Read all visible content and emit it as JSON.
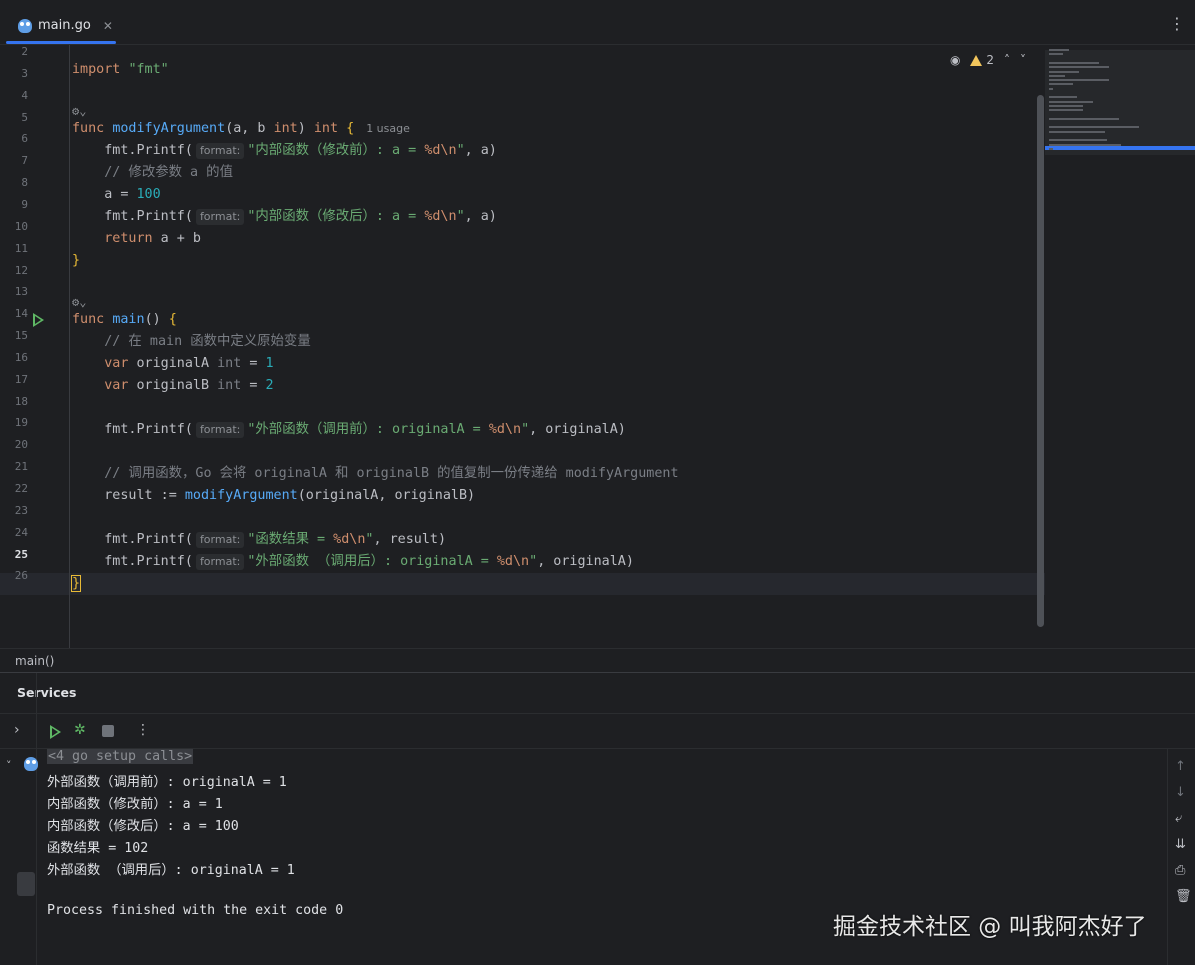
{
  "tabs": [
    {
      "label": "main.go",
      "icon": "go-file-icon",
      "active": true
    }
  ],
  "editor": {
    "line_numbers": [
      "2",
      "3",
      "4",
      "5",
      "6",
      "7",
      "8",
      "9",
      "10",
      "11",
      "12",
      "13",
      "14",
      "15",
      "16",
      "17",
      "18",
      "19",
      "20",
      "21",
      "22",
      "23",
      "24",
      "25",
      "26"
    ],
    "current_line": "25",
    "inspection_count": "2",
    "usage_hint": "1 usage",
    "param_hint": "format:",
    "lines": {
      "l3": [
        "import ",
        "\"fmt\""
      ],
      "l5": [
        "func ",
        "modifyArgument",
        "(a, b ",
        "int",
        ") ",
        "int",
        " {"
      ],
      "l6": [
        "    fmt.Printf(",
        "\"内部函数（修改前）: a = ",
        "%d\\n",
        "\"",
        ", a)"
      ],
      "l7": "    // 修改参数 a 的值",
      "l8": [
        "    a = ",
        "100"
      ],
      "l9": [
        "    fmt.Printf(",
        "\"内部函数（修改后）: a = ",
        "%d\\n",
        "\"",
        ", a)"
      ],
      "l10": [
        "    ",
        "return",
        " a + b"
      ],
      "l11": "}",
      "l13": [
        "func ",
        "main",
        "() ",
        "{"
      ],
      "l14": "    // 在 main 函数中定义原始变量",
      "l15": [
        "    ",
        "var",
        " originalA ",
        "int",
        " = ",
        "1"
      ],
      "l16": [
        "    ",
        "var",
        " originalB ",
        "int",
        " = ",
        "2"
      ],
      "l18": [
        "    fmt.Printf(",
        "\"外部函数（调用前）: originalA = ",
        "%d\\n",
        "\"",
        ", originalA)"
      ],
      "l20": "    // 调用函数，Go 会将 originalA 和 originalB 的值复制一份传递给 modifyArgument",
      "l21": [
        "    result := ",
        "modifyArgument",
        "(originalA, originalB)"
      ],
      "l23": [
        "    fmt.Printf(",
        "\"函数结果 = ",
        "%d\\n",
        "\"",
        ", result)"
      ],
      "l24": [
        "    fmt.Printf(",
        "\"外部函数 （调用后）: originalA = ",
        "%d\\n",
        "\"",
        ", originalA)"
      ],
      "l25": "}"
    }
  },
  "breadcrumb": "main()",
  "services": {
    "title": "Services",
    "console": {
      "setup": "<4 go setup calls>",
      "output": [
        "外部函数（调用前）: originalA = 1",
        "内部函数（修改前）: a = 1",
        "内部函数（修改后）: a = 100",
        "函数结果 = 102",
        "外部函数 （调用后）: originalA = 1"
      ],
      "exit": "Process finished with the exit code 0"
    }
  },
  "watermark": "掘金技术社区 @ 叫我阿杰好了",
  "colors": {
    "accent": "#3574f0",
    "run": "#5fb865",
    "keyword": "#cf8e6d",
    "function": "#57aaf7",
    "string": "#6aab73",
    "number": "#2aacb8",
    "comment": "#7a7e85"
  }
}
